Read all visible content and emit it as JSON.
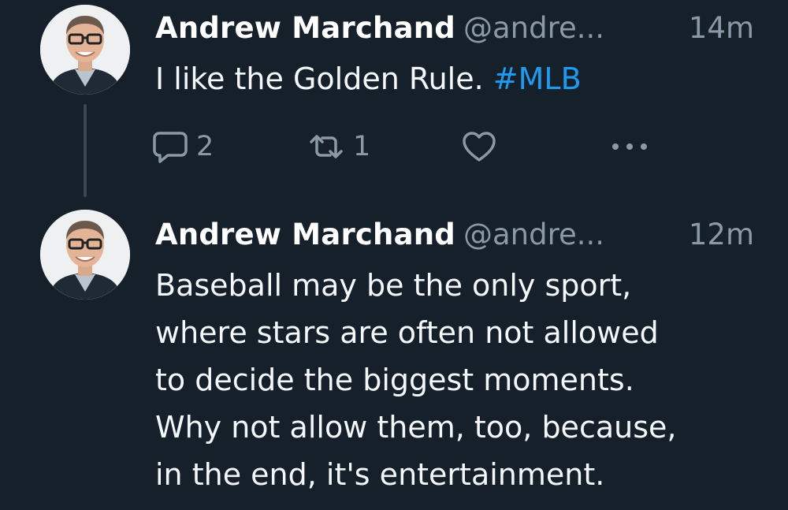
{
  "tweets": [
    {
      "display_name": "Andrew Marchand",
      "handle": "@andre...",
      "time": "14m",
      "text": "I like the Golden Rule.",
      "hashtag": "#MLB",
      "reply_count": "2",
      "retweet_count": "1",
      "avatar_icon": "avatar-photo",
      "reply_icon": "reply-icon",
      "retweet_icon": "retweet-icon",
      "like_icon": "heart-icon",
      "more_icon": "more-icon"
    },
    {
      "display_name": "Andrew Marchand",
      "handle": "@andre...",
      "time": "12m",
      "text_lines": [
        "Baseball may be the only sport,",
        "where stars are often not allowed",
        "to decide the biggest moments.",
        "Why not allow them, too, because,",
        "in the end, it's entertainment."
      ],
      "avatar_icon": "avatar-photo"
    }
  ],
  "colors": {
    "background": "#16202b",
    "text": "#f5f8fa",
    "secondary": "#8b98a5",
    "hashtag": "#1d9bf0",
    "thread_line": "#3c4753"
  }
}
